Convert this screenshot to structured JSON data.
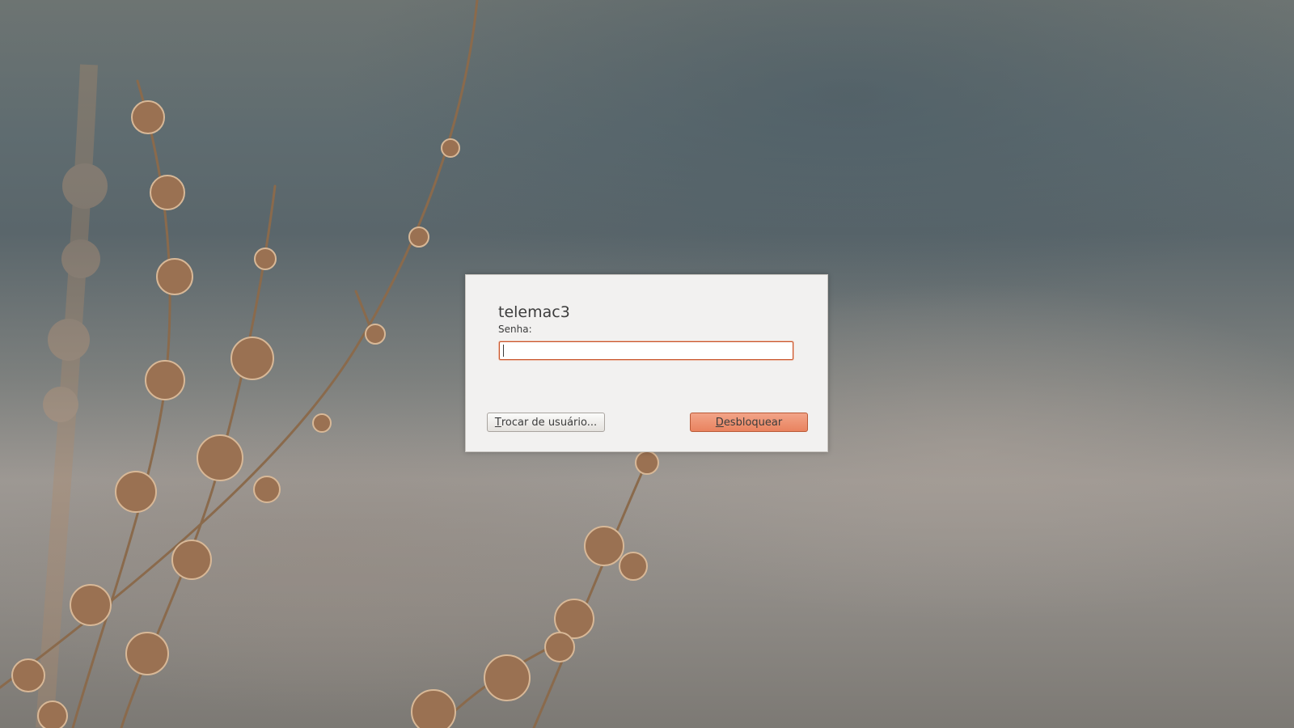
{
  "lock_dialog": {
    "username": "telemac3",
    "password_label": "Senha:",
    "password_value": "",
    "switch_user_button": {
      "mnemonic": "T",
      "rest": "rocar de usuário..."
    },
    "unlock_button": {
      "mnemonic": "D",
      "rest": "esbloquear"
    }
  },
  "colors": {
    "dialog_bg": "#f2f1f0",
    "focus_border": "#c8542a",
    "unlock_button": "#e9835f"
  }
}
